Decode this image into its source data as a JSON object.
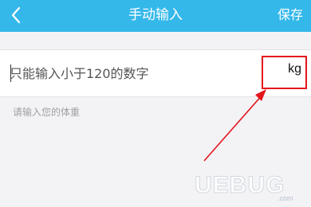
{
  "header": {
    "title": "手动输入",
    "save_label": "保存",
    "back_icon": "chevron-left-icon",
    "background_color": "#34b8ea"
  },
  "weight_field": {
    "value": "",
    "placeholder": "只能输入小于120的数字",
    "unit": "kg"
  },
  "hint_text": "请输入您的体重",
  "annotation": {
    "highlight_color": "#e4161c"
  },
  "watermark": {
    "text": "UEBUG",
    "subtext": ".com"
  }
}
